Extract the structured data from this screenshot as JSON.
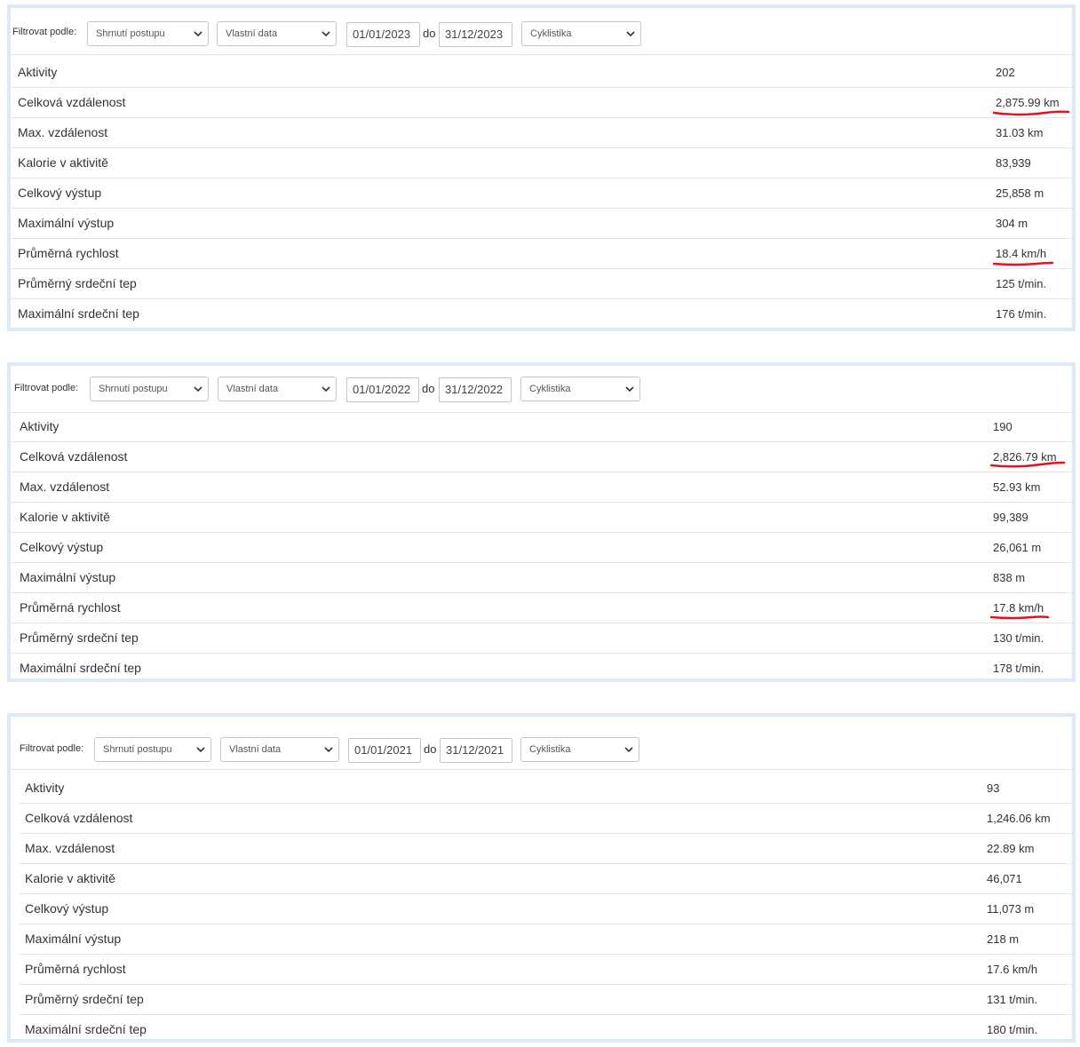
{
  "panels": [
    {
      "filter_label": "Filtrovat podle:",
      "summary_select": "Shrnutí postupu",
      "range_select": "Vlastní data",
      "date_from": "01/01/2023",
      "date_separator": "do",
      "date_to": "31/12/2023",
      "activity_select": "Cyklistika",
      "rows": [
        {
          "label": "Aktivity",
          "value": "202"
        },
        {
          "label": "Celková vzdálenost",
          "value": "2,875.99 km",
          "highlighted": true
        },
        {
          "label": "Max. vzdálenost",
          "value": "31.03 km"
        },
        {
          "label": "Kalorie v aktivitě",
          "value": "83,939"
        },
        {
          "label": "Celkový výstup",
          "value": "25,858 m"
        },
        {
          "label": "Maximální výstup",
          "value": "304 m"
        },
        {
          "label": "Průměrná rychlost",
          "value": "18.4 km/h",
          "highlighted": true
        },
        {
          "label": "Průměrný srdeční tep",
          "value": "125 t/min."
        },
        {
          "label": "Maximální srdeční tep",
          "value": "176 t/min."
        }
      ]
    },
    {
      "filter_label": "Filtrovat podle:",
      "summary_select": "Shrnutí postupu",
      "range_select": "Vlastní data",
      "date_from": "01/01/2022",
      "date_separator": "do",
      "date_to": "31/12/2022",
      "activity_select": "Cyklistika",
      "rows": [
        {
          "label": "Aktivity",
          "value": "190"
        },
        {
          "label": "Celková vzdálenost",
          "value": "2,826.79 km",
          "highlighted": true
        },
        {
          "label": "Max. vzdálenost",
          "value": "52.93 km"
        },
        {
          "label": "Kalorie v aktivitě",
          "value": "99,389"
        },
        {
          "label": "Celkový výstup",
          "value": "26,061 m"
        },
        {
          "label": "Maximální výstup",
          "value": "838 m"
        },
        {
          "label": "Průměrná rychlost",
          "value": "17.8 km/h",
          "highlighted": true
        },
        {
          "label": "Průměrný srdeční tep",
          "value": "130 t/min."
        },
        {
          "label": "Maximální srdeční tep",
          "value": "178 t/min."
        }
      ]
    },
    {
      "filter_label": "Filtrovat podle:",
      "summary_select": "Shrnutí postupu",
      "range_select": "Vlastní data",
      "date_from": "01/01/2021",
      "date_separator": "do",
      "date_to": "31/12/2021",
      "activity_select": "Cyklistika",
      "rows": [
        {
          "label": "Aktivity",
          "value": "93"
        },
        {
          "label": "Celková vzdálenost",
          "value": "1,246.06 km"
        },
        {
          "label": "Max. vzdálenost",
          "value": "22.89 km"
        },
        {
          "label": "Kalorie v aktivitě",
          "value": "46,071"
        },
        {
          "label": "Celkový výstup",
          "value": "11,073 m"
        },
        {
          "label": "Maximální výstup",
          "value": "218 m"
        },
        {
          "label": "Průměrná rychlost",
          "value": "17.6 km/h"
        },
        {
          "label": "Průměrný srdeční tep",
          "value": "131 t/min."
        },
        {
          "label": "Maximální srdeční tep",
          "value": "180 t/min."
        }
      ]
    }
  ],
  "colors": {
    "panel_border": "#dde9f6",
    "row_divider": "#e4e4e4",
    "annotation": "#e8101e"
  },
  "icons": {
    "select_arrow": "chevron-down-icon"
  }
}
